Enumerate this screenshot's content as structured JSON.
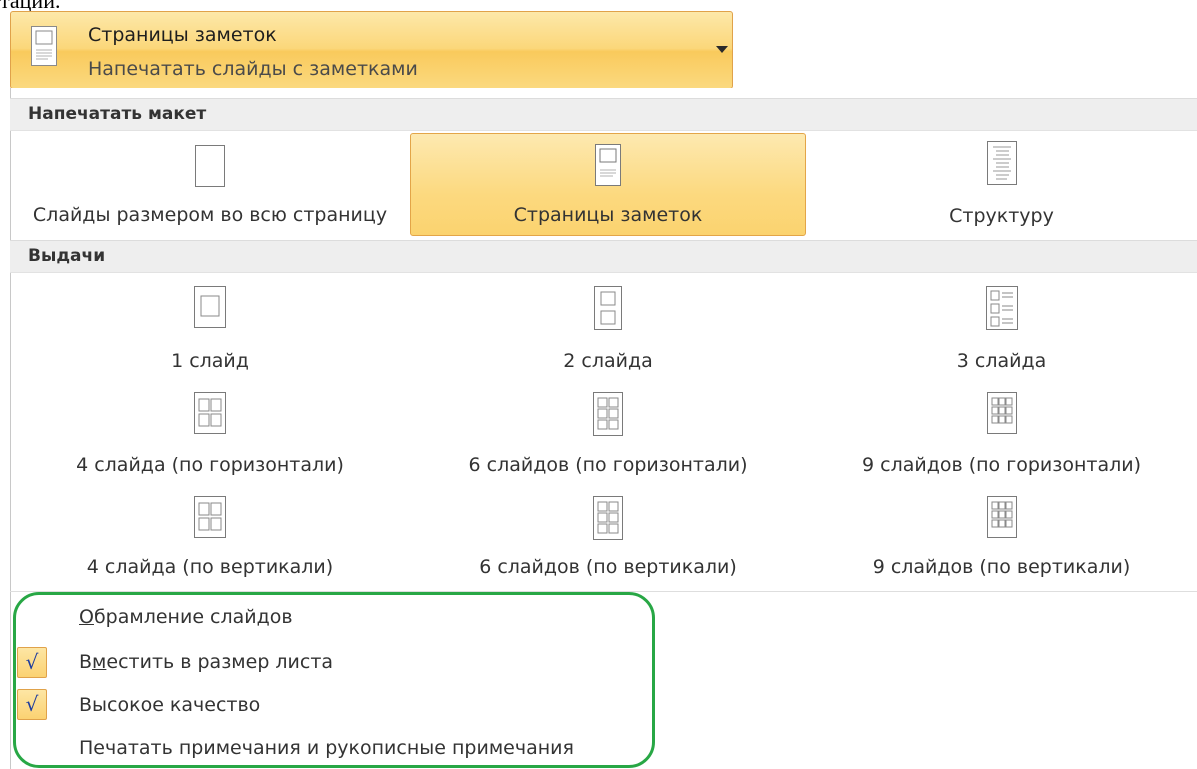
{
  "top_fragment": "тации.",
  "header": {
    "title": "Страницы заметок",
    "subtitle": "Напечатать слайды с заметками"
  },
  "sections": {
    "print_layout": "Напечатать макет",
    "handouts": "Выдачи"
  },
  "print_layout_items": [
    {
      "label": "Слайды размером во всю страницу",
      "icon": "full-page-slide-icon",
      "selected": false
    },
    {
      "label": "Страницы заметок",
      "icon": "notes-page-icon",
      "selected": true
    },
    {
      "label": "Структуру",
      "icon": "outline-icon",
      "selected": false
    }
  ],
  "handout_items": [
    {
      "label": "1 слайд",
      "icon": "one-slide-icon"
    },
    {
      "label": "2 слайда",
      "icon": "two-slides-icon"
    },
    {
      "label": "3 слайда",
      "icon": "three-slides-icon"
    },
    {
      "label": "4 слайда (по горизонтали)",
      "icon": "four-slides-horizontal-icon"
    },
    {
      "label": "6 слайдов (по горизонтали)",
      "icon": "six-slides-horizontal-icon"
    },
    {
      "label": "9 слайдов (по горизонтали)",
      "icon": "nine-slides-horizontal-icon"
    },
    {
      "label": "4 слайда (по вертикали)",
      "icon": "four-slides-vertical-icon"
    },
    {
      "label": "6 слайдов (по вертикали)",
      "icon": "six-slides-vertical-icon"
    },
    {
      "label": "9 слайдов (по вертикали)",
      "icon": "nine-slides-vertical-icon"
    }
  ],
  "options": {
    "frame_slides": {
      "accel": "О",
      "rest": "брамление слайдов",
      "checked": false
    },
    "scale_to_fit": {
      "pre": "В",
      "accel": "м",
      "rest": "естить в размер листа",
      "checked": true
    },
    "high_quality": {
      "label": "Высокое качество",
      "checked": true
    },
    "print_comments": {
      "label": "Печатать примечания и рукописные примечания",
      "checked": false
    }
  },
  "check_glyph": "√",
  "colors": {
    "selected_fill": "#fbd77a",
    "selected_border": "#e0a24a",
    "highlight_frame": "#28a745"
  }
}
